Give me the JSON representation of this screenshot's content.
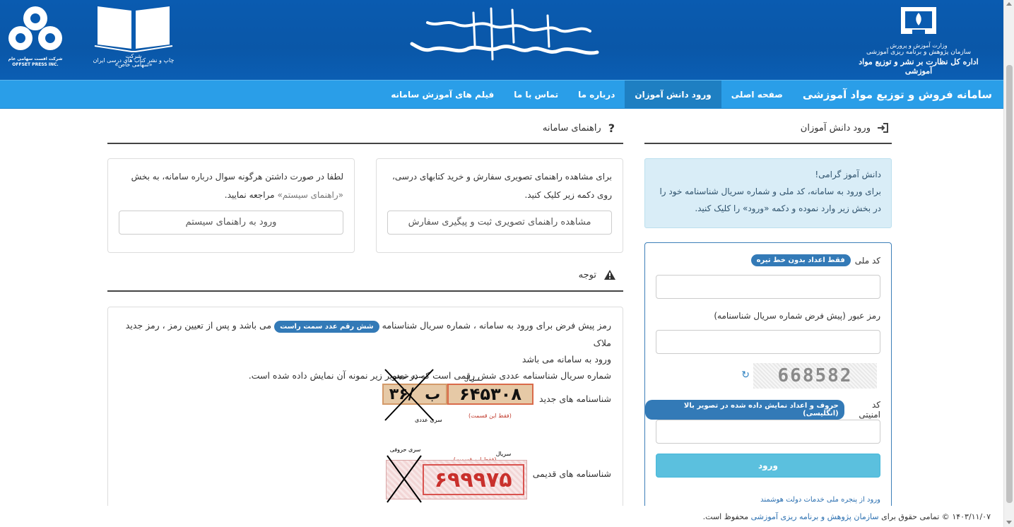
{
  "banner": {
    "ministry_line1": "وزارت آموزش و پرورش",
    "ministry_line2": "سازمان پژوهش و برنامه ریزی آموزشی",
    "ministry_line3": "اداره کل نظارت بر نشر و توزیع مواد آموزشی",
    "publisher_line1": "شرکت",
    "publisher_line2": "چاپ و نشر کتاب های درسی ایران",
    "publisher_line3": "«سهامی خاص»",
    "offset_line1": "شرکت افست سهامی عام",
    "offset_line2": "OFFSET PRESS INC."
  },
  "nav": {
    "brand": "سامانه فروش و توزیع مواد آموزشی",
    "items": [
      {
        "label": "صفحه اصلی"
      },
      {
        "label": "ورود دانش آموزان"
      },
      {
        "label": "درباره ما"
      },
      {
        "label": "تماس با ما"
      },
      {
        "label": "فیلم های آموزش سامانه"
      }
    ]
  },
  "login": {
    "header": "ورود دانش آموزان",
    "greeting_title": "دانش آموز گرامی!",
    "greeting_body": "برای ورود به سامانه، کد ملی و شماره سریال شناسنامه خود را در بخش زیر وارد نموده و دکمه «ورود» را کلیک کنید.",
    "national_code_label": "کد ملی",
    "national_code_hint": "فقط اعداد بدون خط تیره",
    "password_label": "رمز عبور (پیش فرض شماره سریال شناسنامه)",
    "captcha_text": "668582",
    "security_label": "کد امنیتی",
    "security_hint": "حروف و اعداد نمایش داده شده در تصویر بالا (انگلیسی)",
    "submit": "ورود",
    "gov_link": "ورود از پنجره ملی خدمات دولت هوشمند"
  },
  "guide": {
    "header": "راهنمای سامانه",
    "card_a_text": "برای مشاهده راهنمای تصویری سفارش و خرید کتابهای درسی، روی دکمه زیر کلیک کنید.",
    "card_a_button": "مشاهده راهنمای تصویری ثبت و پیگیری سفارش",
    "card_b_text_1": "لطفا در صورت داشتن هرگونه سوال درباره سامانه، به بخش",
    "card_b_text_2": "«راهنمای سیستم»",
    "card_b_text_3": "مراجعه نمایید.",
    "card_b_button": "ورود به راهنمای سیستم"
  },
  "notice": {
    "header": "توجه",
    "line1_a": "رمز پیش فرض برای ورود به سامانه ، شماره سریال شناسنامه",
    "line1_badge": "شش رقم عدد سمت راست",
    "line1_b": "می باشد و پس از تعیین رمز ، رمز جدید ملاک",
    "line2": "ورود به سامانه می باشد",
    "line3": "شماره سریال شناسنامه عددی شش رقمی است که در تصویر زیر نمونه آن نمایش داده شده است.",
    "new_label": "شناسنامه های جدید",
    "old_label": "شناسنامه های قدیمی",
    "new_serial": "۶۴۵۳۰۸",
    "new_prefix": "۳۶/",
    "new_letter": "ب",
    "old_serial": "۶۹۹۹۷۵",
    "serial_word": "سریال",
    "letter_series": "سری حروفی",
    "number_series": "سری عددی",
    "only_this": "(فقط این قسمت)"
  },
  "footer": {
    "date": "۱۴۰۳/۱۱/۰۷",
    "text_a": "© تمامی حقوق برای",
    "org": "سازمان پژوهش و برنامه ریزی آموزشی",
    "text_b": "محفوظ است."
  }
}
